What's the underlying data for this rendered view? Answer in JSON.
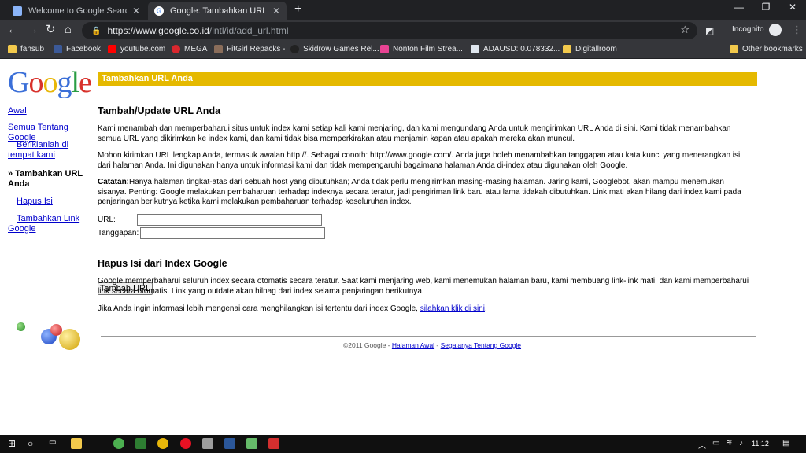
{
  "browser": {
    "tabs": [
      {
        "title": "Welcome to Google Search Cons",
        "active": false
      },
      {
        "title": "Google: Tambahkan URL Anda",
        "active": true
      }
    ],
    "new_tab": "+",
    "address": {
      "domain": "https://www.google.co.id",
      "path": "/intl/id/add_url.html"
    },
    "incognito_label": "Incognito",
    "bookmarks": [
      {
        "label": "fansub",
        "icon": "folder-icon",
        "color": "#f2c94c"
      },
      {
        "label": "Facebook",
        "icon": "facebook-icon",
        "color": "#3b5998"
      },
      {
        "label": "youtube.com",
        "icon": "youtube-icon",
        "color": "#ff0000"
      },
      {
        "label": "MEGA",
        "icon": "mega-icon",
        "color": "#d9272e"
      },
      {
        "label": "FitGirl Repacks -",
        "icon": "fitgirl-icon",
        "color": "#8a6d5a"
      },
      {
        "label": "Skidrow Games Rel...",
        "icon": "skidrow-icon",
        "color": "#222222"
      },
      {
        "label": "Nonton Film Strea...",
        "icon": "nonton-icon",
        "color": "#e84393"
      },
      {
        "label": "ADAUSD: 0.078332...",
        "icon": "chart-icon",
        "color": "#dfe6ee"
      },
      {
        "label": "Digitallroom",
        "icon": "folder-icon",
        "color": "#f2c94c"
      },
      {
        "label": "Other bookmarks",
        "icon": "folder-icon",
        "color": "#f2c94c"
      }
    ]
  },
  "page": {
    "logo_text": "Google",
    "header_bar": "Tambahkan URL Anda",
    "sidenav": [
      {
        "label": "Awal",
        "link": true,
        "indent": false
      },
      {
        "label": "Semua Tentang Google",
        "link": true,
        "indent": false
      },
      {
        "label": "Beriklanlah di tempat kami",
        "link": true,
        "indent": true
      },
      {
        "label": "» Tambahkan URL Anda",
        "link": false,
        "indent": false
      },
      {
        "label": "Hapus Isi",
        "link": true,
        "indent": true
      },
      {
        "label": "Tambahkan Link Google",
        "link": true,
        "indent": true
      }
    ],
    "section1_title": "Tambah/Update URL Anda",
    "p1": "Kami menambah dan memperbaharui situs untuk index kami setiap kali kami menjaring, dan kami mengundang Anda untuk mengirimkan URL Anda di sini. Kami tidak menambahkan semua URL yang dikirimkan ke index kami, dan kami tidak bisa memperkirakan atau menjamin kapan atau apakah mereka akan muncul.",
    "p2": "Mohon kirimkan URL lengkap Anda, termasuk awalan http://. Sebagai conoth: http://www.google.com/. Anda juga boleh menambahkan tanggapan atau kata kunci yang menerangkan isi dari halaman Anda. Ini digunakan hanya untuk informasi kami dan tidak mempengaruhi bagaimana halaman Anda di-index atau digunakan oleh Google.",
    "note_label": "Catatan:",
    "note_text": "Hanya halaman tingkat-atas dari sebuah host yang dibutuhkan; Anda tidak perlu mengirimkan masing-masing halaman. Jaring kami, Googlebot, akan mampu menemukan sisanya. Penting: Google melakukan pembaharuan terhadap indexnya secara teratur, jadi pengiriman link baru atau lama tidakah dibutuhkan. Link mati akan hilang dari index kami pada penjaringan berikutnya ketika kami melakukan pembaharuan terhadap keseluruhan index.",
    "url_label": "URL:",
    "comments_label": "Tanggapan:",
    "submit_label": "Tambah URL",
    "section2_title": "Hapus Isi dari Index Google",
    "p3": "Google memperbaharui seluruh index secara otomatis secara teratur. Saat kami menjaring web, kami menemukan halaman baru, kami membuang link-link mati, dan kami memperbaharui link secara otomatis. Link yang outdate akan hilnag dari index selama penjaringan berikutnya.",
    "p4_text": "Jika Anda ingin informasi lebih mengenai cara menghilangkan isi tertentu dari index Google, ",
    "p4_link": "silahkan klik di sini",
    "p4_end": ".",
    "footer_copy": "©2011 Google - ",
    "footer_link1": "Halaman Awal",
    "footer_sep": " - ",
    "footer_link2": "Segalanya Tentang Google"
  },
  "taskbar": {
    "clock": "11:12"
  }
}
